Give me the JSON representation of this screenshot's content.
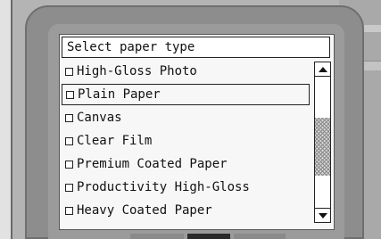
{
  "dialog": {
    "title": "Select paper type",
    "items": [
      {
        "label": "High-Gloss Photo",
        "checked": false,
        "selected": false
      },
      {
        "label": "Plain Paper",
        "checked": false,
        "selected": true
      },
      {
        "label": "Canvas",
        "checked": false,
        "selected": false
      },
      {
        "label": "Clear Film",
        "checked": false,
        "selected": false
      },
      {
        "label": "Premium Coated Paper",
        "checked": false,
        "selected": false
      },
      {
        "label": "Productivity High-Gloss",
        "checked": false,
        "selected": false
      },
      {
        "label": "Heavy Coated Paper",
        "checked": false,
        "selected": false
      }
    ],
    "scroll": {
      "position": 0.56,
      "visible_fraction": 0.44
    }
  },
  "icons": {
    "scroll_up": "arrow-up-icon",
    "scroll_down": "arrow-down-icon"
  },
  "colors": {
    "device_body": "#8d8d8d",
    "screen_background": "#f7f7f7",
    "text": "#111111"
  }
}
